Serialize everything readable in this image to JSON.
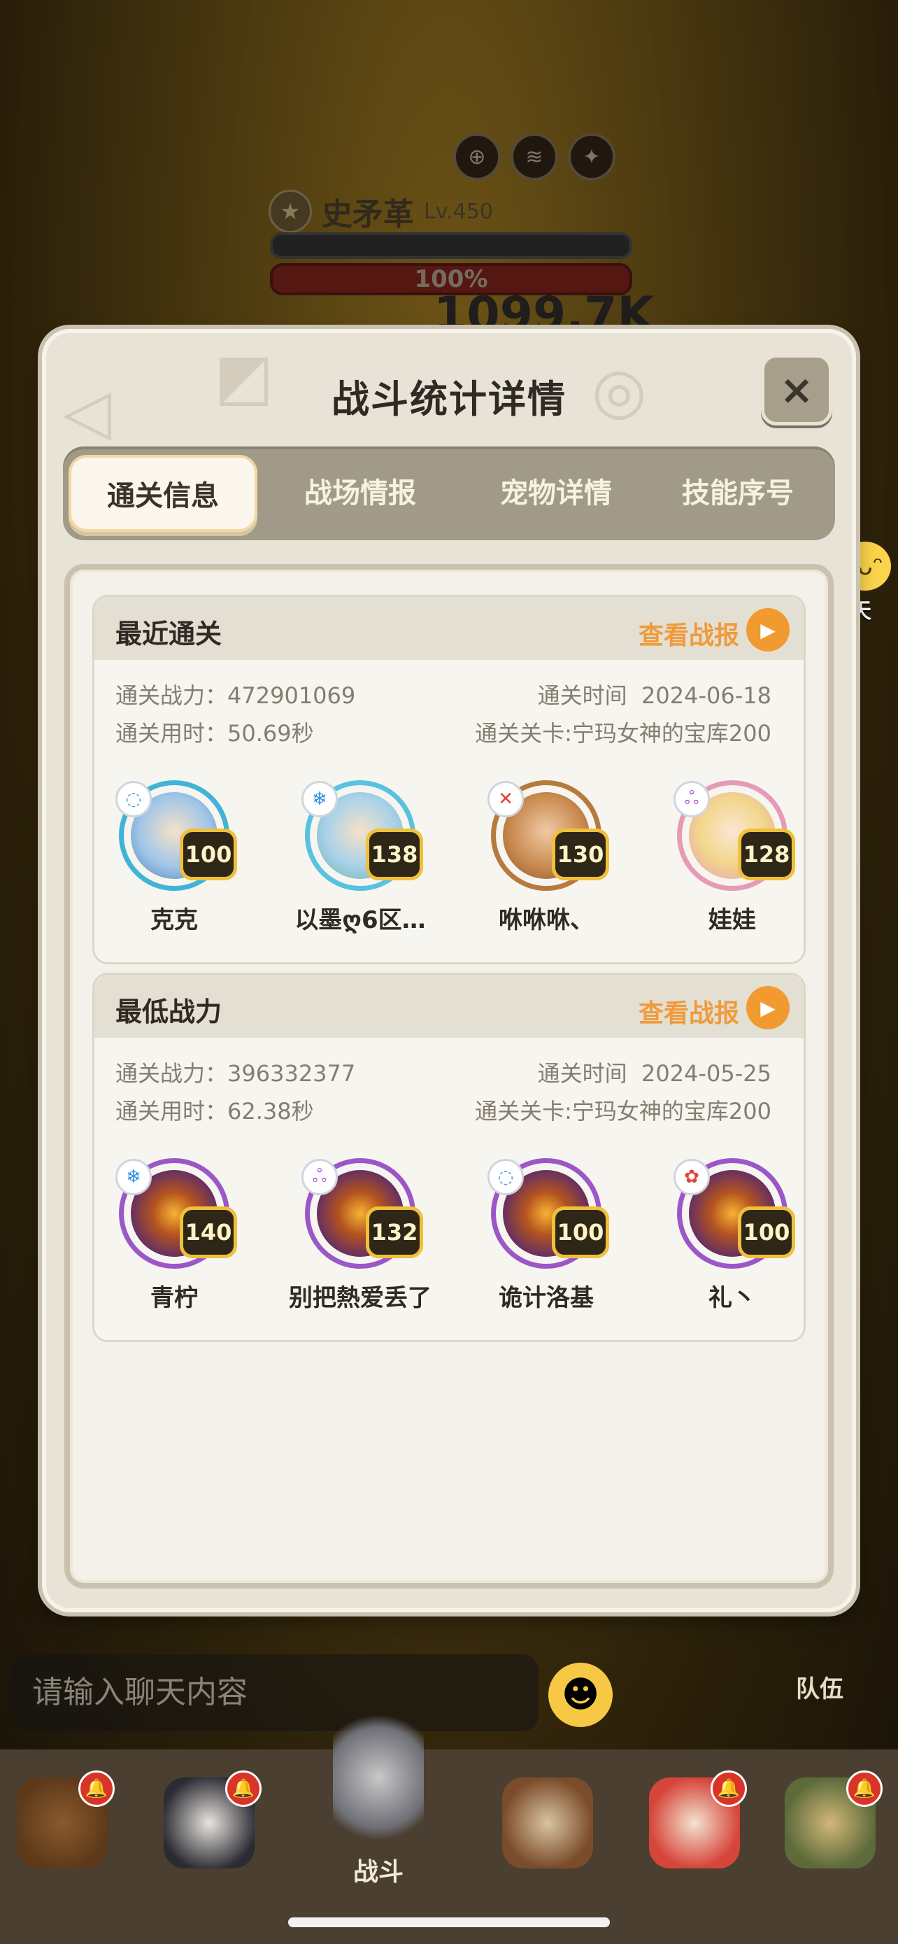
{
  "boss": {
    "name": "史矛革",
    "level": "Lv.450",
    "hp_percent": "100%",
    "damage": "1099.7K",
    "icons": [
      "target-icon",
      "claw-icon",
      "wing-icon"
    ]
  },
  "dialog": {
    "title": "战斗统计详情",
    "close_label": "×"
  },
  "tabs": [
    {
      "label": "通关信息",
      "active": true
    },
    {
      "label": "战场情报",
      "active": false
    },
    {
      "label": "宠物详情",
      "active": false
    },
    {
      "label": "技能序号",
      "active": false
    }
  ],
  "cards": [
    {
      "title": "最近通关",
      "report_label": "查看战报",
      "power_label": "通关战力：",
      "power": "472901069",
      "time_used_label": "通关用时：",
      "time_used": "50.69秒",
      "date_label": "通关时间",
      "date": "2024-06-18",
      "stage_label": "通关关卡:",
      "stage": "宁玛女神的宝库200",
      "heroes": [
        {
          "name": "克克",
          "level": "100",
          "element": "wind",
          "ring": "#3fb4d6"
        },
        {
          "name": "以墨ღ6区…",
          "level": "138",
          "element": "ice",
          "ring": "#58c2e0"
        },
        {
          "name": "咻咻咻、",
          "level": "130",
          "element": "fire",
          "ring": "#b77a3e"
        },
        {
          "name": "娃娃",
          "level": "128",
          "element": "arcane",
          "ring": "#e59bb6"
        }
      ]
    },
    {
      "title": "最低战力",
      "report_label": "查看战报",
      "power_label": "通关战力：",
      "power": "396332377",
      "time_used_label": "通关用时：",
      "time_used": "62.38秒",
      "date_label": "通关时间",
      "date": "2024-05-25",
      "stage_label": "通关关卡:",
      "stage": "宁玛女神的宝库200",
      "heroes": [
        {
          "name": "青柠",
          "level": "140",
          "element": "ice",
          "ring": "#9b57c8"
        },
        {
          "name": "别把熱爱丢了",
          "level": "132",
          "element": "arcane",
          "ring": "#9b57c8"
        },
        {
          "name": "诡计洛基",
          "level": "100",
          "element": "wind",
          "ring": "#9b57c8"
        },
        {
          "name": "礼丶",
          "level": "100",
          "element": "fire",
          "ring": "#9b57c8"
        }
      ]
    }
  ],
  "chat": {
    "bubble_label": "聊天",
    "input_placeholder": "请输入聊天内容",
    "team_label": "队伍"
  },
  "nav": {
    "battle_label": "战斗"
  },
  "colors": {
    "accent_orange": "#ef9b3c",
    "badge_gold": "#f0c03a"
  }
}
